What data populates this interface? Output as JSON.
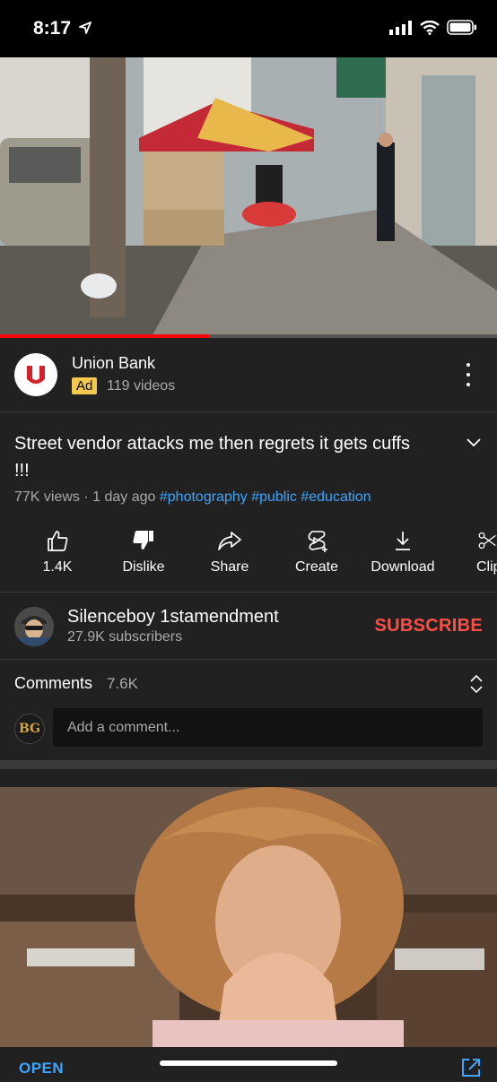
{
  "status_bar": {
    "time": "8:17"
  },
  "video": {
    "progress_fraction": 0.42
  },
  "ad": {
    "title": "Union Bank",
    "badge": "Ad",
    "meta": "119 videos"
  },
  "video_info": {
    "title": "Street vendor attacks me then regrets it gets cuffs !!!",
    "meta_text": "77K views · 1 day ago",
    "hashtags": [
      "#photography",
      "#public",
      "#education"
    ]
  },
  "actions": [
    {
      "label": "1.4K",
      "icon": "thumbs-up-icon"
    },
    {
      "label": "Dislike",
      "icon": "thumbs-down-icon"
    },
    {
      "label": "Share",
      "icon": "share-icon"
    },
    {
      "label": "Create",
      "icon": "create-icon"
    },
    {
      "label": "Download",
      "icon": "download-icon"
    },
    {
      "label": "Clip",
      "icon": "clip-icon"
    }
  ],
  "channel": {
    "name": "Silenceboy 1stamendment",
    "subscribers": "27.9K subscribers",
    "subscribe_label": "SUBSCRIBE"
  },
  "comments": {
    "title": "Comments",
    "count": "7.6K",
    "avatar_initials": "BG",
    "placeholder": "Add a comment..."
  },
  "promo": {
    "open_label": "OPEN"
  },
  "colors": {
    "background": "#212121",
    "accent_red": "#ff4e45",
    "link_blue": "#3ea6ff",
    "progress_red": "#ff0000"
  }
}
